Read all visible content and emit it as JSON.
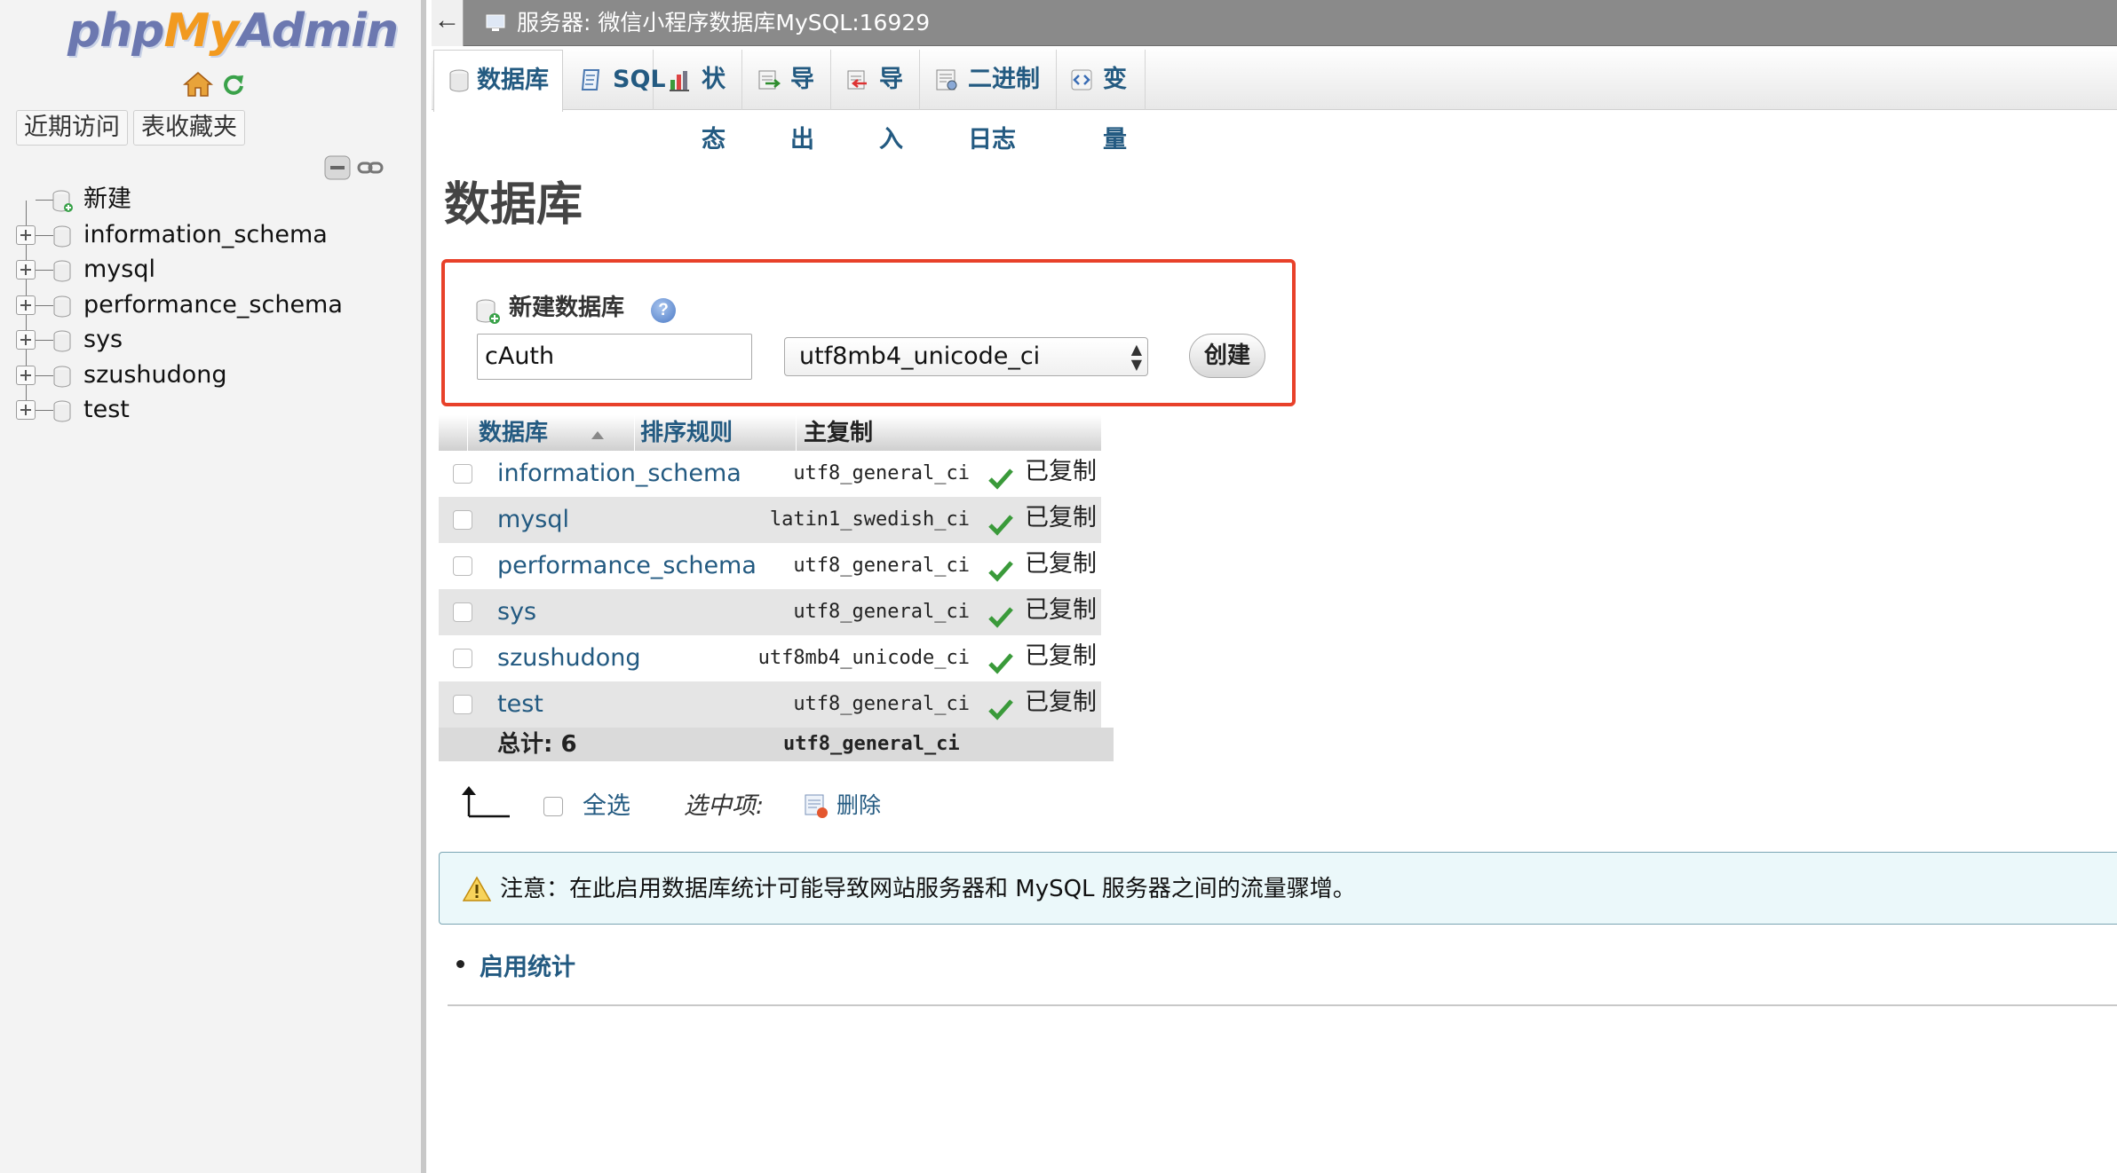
{
  "logo": {
    "part1": "php",
    "part2": "My",
    "part3": "Admin"
  },
  "nav": {
    "tabs": [
      {
        "label": "近期访问"
      },
      {
        "label": "表收藏夹"
      }
    ],
    "tree": [
      {
        "label": "新建",
        "kind": "new"
      },
      {
        "label": "information_schema",
        "kind": "db"
      },
      {
        "label": "mysql",
        "kind": "db"
      },
      {
        "label": "performance_schema",
        "kind": "db"
      },
      {
        "label": "sys",
        "kind": "db"
      },
      {
        "label": "szushudong",
        "kind": "db"
      },
      {
        "label": "test",
        "kind": "db"
      }
    ]
  },
  "topbar": {
    "back_label": "←",
    "server_title": "服务器: 微信小程序数据库MySQL:16929"
  },
  "menu": {
    "tabs": [
      {
        "label": "数据库",
        "icon": "database-icon",
        "active": true
      },
      {
        "label": "SQL",
        "icon": "sql-icon",
        "active": false
      },
      {
        "label": "状态",
        "icon": "status-icon",
        "active": false
      },
      {
        "label": "导出",
        "icon": "export-icon",
        "active": false
      },
      {
        "label": "导入",
        "icon": "import-icon",
        "active": false
      },
      {
        "label": "二进制日志",
        "icon": "binlog-icon",
        "active": false
      },
      {
        "label": "变量",
        "icon": "variables-icon",
        "active": false
      }
    ]
  },
  "page": {
    "title": "数据库"
  },
  "create_db": {
    "heading": "新建数据库",
    "help": "?",
    "name_value": "cAuth",
    "collation_value": "utf8mb4_unicode_ci",
    "button_label": "创建",
    "highlight_color": "#e8412a"
  },
  "table": {
    "headers": {
      "database": "数据库",
      "collation": "排序规则",
      "replication": "主复制"
    },
    "rows": [
      {
        "name": "information_schema",
        "collation": "utf8_general_ci",
        "replication": "已复制"
      },
      {
        "name": "mysql",
        "collation": "latin1_swedish_ci",
        "replication": "已复制"
      },
      {
        "name": "performance_schema",
        "collation": "utf8_general_ci",
        "replication": "已复制"
      },
      {
        "name": "sys",
        "collation": "utf8_general_ci",
        "replication": "已复制"
      },
      {
        "name": "szushudong",
        "collation": "utf8mb4_unicode_ci",
        "replication": "已复制"
      },
      {
        "name": "test",
        "collation": "utf8_general_ci",
        "replication": "已复制"
      }
    ],
    "total_label": "总计: 6",
    "total_collation": "utf8_general_ci"
  },
  "bulk": {
    "select_all": "全选",
    "with_selected": "选中项:",
    "delete": "删除"
  },
  "notice": {
    "text": "注意：在此启用数据库统计可能导致网站服务器和 MySQL 服务器之间的流量骤增。"
  },
  "links": {
    "enable_stats": "启用统计"
  },
  "colors": {
    "link": "#235a81",
    "topbar": "#8a8a8a",
    "notice_bg": "#ebf8fa"
  }
}
